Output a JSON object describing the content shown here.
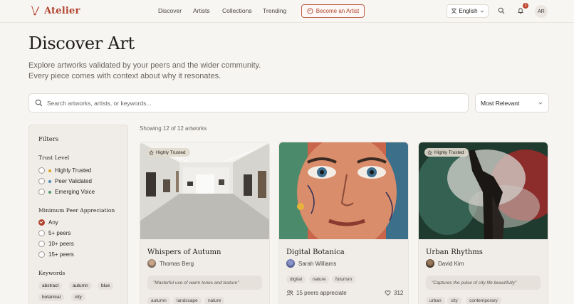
{
  "header": {
    "brand": "Atelier",
    "nav": [
      "Discover",
      "Artists",
      "Collections",
      "Trending"
    ],
    "cta_label": "Become an Artist",
    "language": "English",
    "notification_count": "3",
    "avatar_initials": "AR"
  },
  "hero": {
    "title": "Discover Art",
    "subtitle": "Explore artworks validated by your peers and the wider community. Every piece comes with context about why it resonates."
  },
  "search": {
    "placeholder": "Search artworks, artists, or keywords...",
    "sort_value": "Most Relevant"
  },
  "filters": {
    "title": "Filters",
    "trust_heading": "Trust Level",
    "trust_options": [
      {
        "label": "Highly Trusted",
        "color": "#e0a526"
      },
      {
        "label": "Peer Validated",
        "color": "#4a8fb5"
      },
      {
        "label": "Emerging Voice",
        "color": "#4f9a6a"
      }
    ],
    "peer_heading": "Minimum Peer Appreciation",
    "peer_options": [
      "Any",
      "5+ peers",
      "10+ peers",
      "15+ peers"
    ],
    "peer_selected": "Any",
    "keywords_heading": "Keywords",
    "keywords": [
      "abstract",
      "autumn",
      "blue",
      "botanical",
      "city"
    ]
  },
  "results": {
    "showing": "Showing 12 of 12 artworks"
  },
  "cards": [
    {
      "title": "Whispers of Autumn",
      "artist": "Thomas Berg",
      "badge": "Highly Trusted",
      "quote": "\"Masterful use of warm tones and texture\"",
      "tags": [
        "autumn",
        "landscape",
        "nature"
      ]
    },
    {
      "title": "Digital Botanica",
      "artist": "Sarah Williams",
      "tags": [
        "digital",
        "nature",
        "futurism"
      ],
      "peers": "15 peers appreciate",
      "likes": "312"
    },
    {
      "title": "Urban Rhythms",
      "artist": "David Kim",
      "badge": "Highly Trusted",
      "quote": "\"Captures the pulse of city life beautifully\"",
      "tags": [
        "urban",
        "city",
        "contemporary"
      ]
    }
  ],
  "colors": {
    "accent": "#b0432e",
    "background": "#f7f5f2"
  }
}
